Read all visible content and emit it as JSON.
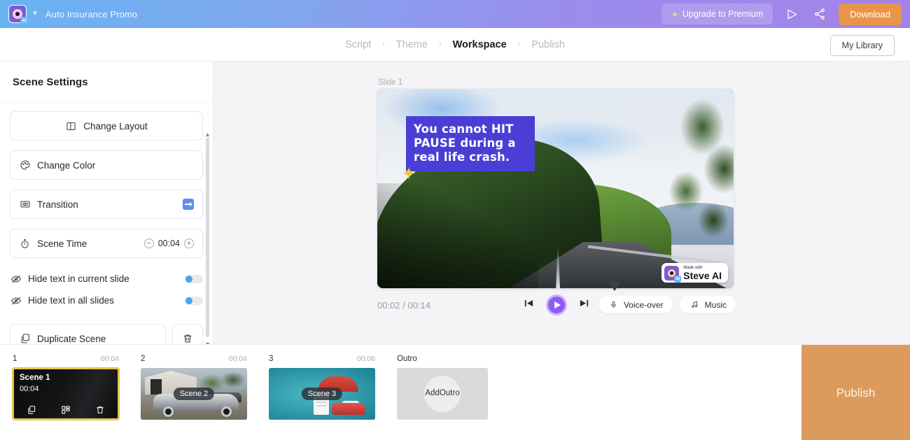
{
  "topbar": {
    "logo_icon": "steve-ai-logo-icon",
    "caret_icon": "chevron-down-icon",
    "project_title": "Auto Insurance Promo",
    "upgrade_label": "Upgrade to Premium",
    "upgrade_star_icon": "star-icon",
    "preview_icon": "play-outline-icon",
    "share_icon": "share-icon",
    "download_label": "Download",
    "accent_download": "#e8954a",
    "gradient_from": "#68b3f2",
    "gradient_to": "#a383ea"
  },
  "breadcrumb": {
    "steps": [
      {
        "label": "Script",
        "active": false
      },
      {
        "label": "Theme",
        "active": false
      },
      {
        "label": "Workspace",
        "active": true
      },
      {
        "label": "Publish",
        "active": false
      }
    ],
    "separator": "›",
    "my_library_label": "My Library"
  },
  "scene_settings": {
    "title": "Scene Settings",
    "change_layout": {
      "label": "Change Layout",
      "icon": "layout-icon"
    },
    "change_color": {
      "label": "Change Color",
      "icon": "palette-icon"
    },
    "transition": {
      "label": "Transition",
      "icon": "transition-icon",
      "swatch_icon": "slide-right-arrow-icon",
      "swatch_color": "#5b8def"
    },
    "scene_time": {
      "label": "Scene Time",
      "icon": "stopwatch-icon",
      "value": "00:04",
      "minus": "−",
      "plus": "+"
    },
    "toggles": [
      {
        "label": "Hide text in current slide",
        "icon": "eye-off-icon",
        "on": false
      },
      {
        "label": "Hide text in all slides",
        "icon": "eye-off-icon",
        "on": false
      }
    ],
    "duplicate_scene": {
      "label": "Duplicate Scene",
      "icon": "copy-icon"
    },
    "delete_icon": "trash-icon",
    "scroll_up_arrow": "▲",
    "scroll_down_arrow": "▼"
  },
  "preview": {
    "slide_label": "Slide 1",
    "caption_line1": "You cannot HIT",
    "caption_line2": "PAUSE during a",
    "caption_line3": "real life crash.",
    "caption_bg": "#4a3ed6",
    "sparkle_glyph": "✦",
    "watermark_made": "Made with",
    "watermark_name": "Steve AI"
  },
  "playback": {
    "current_time": "00:02",
    "separator": "/",
    "total_time": "00:14",
    "prev_icon": "skip-back-icon",
    "play_icon": "play-icon",
    "next_icon": "skip-forward-icon",
    "voiceover": {
      "label": "Voice-over",
      "icon": "microphone-icon"
    },
    "music": {
      "label": "Music",
      "icon": "music-note-icon"
    },
    "play_accent": "#8b5cf6"
  },
  "timeline": {
    "scenes": [
      {
        "num": "1",
        "duration": "00:04",
        "title": "Scene 1",
        "inline_time": "00:04",
        "selected": true,
        "tools": [
          {
            "icon": "duplicate-icon"
          },
          {
            "icon": "layout-grid-icon"
          },
          {
            "icon": "trash-icon"
          }
        ]
      },
      {
        "num": "2",
        "duration": "00:04",
        "chip": "Scene 2",
        "selected": false
      },
      {
        "num": "3",
        "duration": "00:06",
        "chip": "Scene 3",
        "selected": false
      }
    ],
    "outro": {
      "header": "Outro",
      "add_line1": "Add",
      "add_line2": "Outro"
    },
    "selection_color": "#e4c54a",
    "publish": {
      "label": "Publish",
      "bg": "#dc9b5d"
    }
  }
}
